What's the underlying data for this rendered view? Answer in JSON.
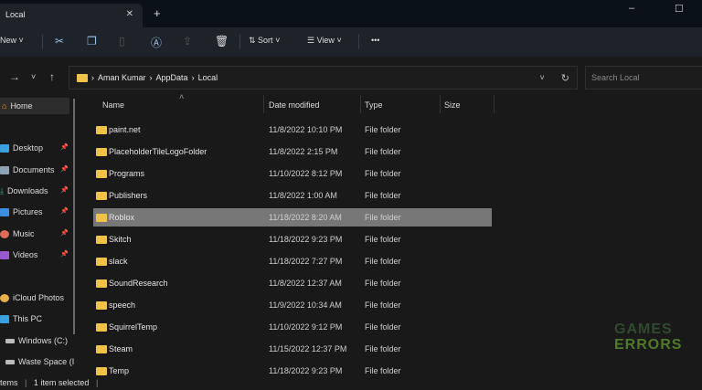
{
  "window": {
    "tab_title": "Local",
    "close_tab": "✕",
    "new_tab": "+",
    "minimize": "–",
    "maximize": "☐"
  },
  "toolbar": {
    "new_label": "New",
    "sort_label": "Sort",
    "view_label": "View",
    "more": "•••"
  },
  "address": {
    "crumbs": [
      "Aman Kumar",
      "AppData",
      "Local"
    ],
    "separator": "›",
    "search_placeholder": "Search Local"
  },
  "sidebar": {
    "home": "Home",
    "quick": [
      {
        "label": "Desktop",
        "color": "#3aa0e0"
      },
      {
        "label": "Documents",
        "color": "#8fa3b8"
      },
      {
        "label": "Downloads",
        "color": "#2fb37a"
      },
      {
        "label": "Pictures",
        "color": "#3b8fe0"
      },
      {
        "label": "Music",
        "color": "#e06a5a"
      },
      {
        "label": "Videos",
        "color": "#9b59d0"
      }
    ],
    "other": [
      "iCloud Photos",
      "This PC",
      "Windows (C:)",
      "Waste Space (I"
    ]
  },
  "columns": {
    "name": "Name",
    "date": "Date modified",
    "type": "Type",
    "size": "Size"
  },
  "files": [
    {
      "name": "paint.net",
      "date": "11/8/2022 10:10 PM",
      "type": "File folder"
    },
    {
      "name": "PlaceholderTileLogoFolder",
      "date": "11/8/2022 2:15 PM",
      "type": "File folder"
    },
    {
      "name": "Programs",
      "date": "11/10/2022 8:12 PM",
      "type": "File folder"
    },
    {
      "name": "Publishers",
      "date": "11/8/2022 1:00 AM",
      "type": "File folder"
    },
    {
      "name": "Roblox",
      "date": "11/18/2022 8:20 AM",
      "type": "File folder",
      "selected": true
    },
    {
      "name": "Skitch",
      "date": "11/18/2022 9:23 PM",
      "type": "File folder"
    },
    {
      "name": "slack",
      "date": "11/18/2022 7:27 PM",
      "type": "File folder"
    },
    {
      "name": "SoundResearch",
      "date": "11/8/2022 12:37 AM",
      "type": "File folder"
    },
    {
      "name": "speech",
      "date": "11/9/2022 10:34 AM",
      "type": "File folder"
    },
    {
      "name": "SquirrelTemp",
      "date": "11/10/2022 9:12 PM",
      "type": "File folder"
    },
    {
      "name": "Steam",
      "date": "11/15/2022 12:37 PM",
      "type": "File folder"
    },
    {
      "name": "Temp",
      "date": "11/18/2022 9:23 PM",
      "type": "File folder"
    }
  ],
  "status": {
    "items": "tems",
    "selected": "1 item selected"
  },
  "watermark": {
    "line1": "GAMES",
    "line2": "ERRORS"
  }
}
